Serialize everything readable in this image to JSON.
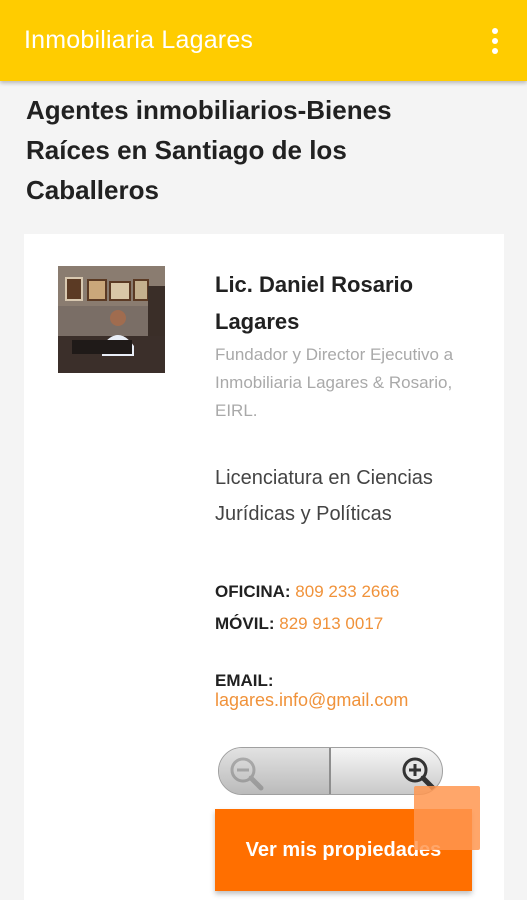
{
  "app": {
    "title": "Inmobiliaria Lagares",
    "menu_icon": "more-vert-icon"
  },
  "page": {
    "heading": "Agentes inmobiliarios-Bienes Raíces en Santiago de los Caballeros"
  },
  "agent": {
    "name": "Lic. Daniel Rosario Lagares",
    "role": "Fundador y Director Ejecutivo a Inmobiliaria Lagares & Rosario, EIRL.",
    "degree": "Licenciatura en Ciencias Jurídicas y Políticas",
    "office_label": "OFICINA:",
    "office_phone": "809 233 2666",
    "mobile_label": "MÓVIL:",
    "mobile_phone": "829 913 0017",
    "email_label": "EMAIL:",
    "email": "lagares.info@gmail.com"
  },
  "zoom": {
    "out_icon": "zoom-out-icon",
    "in_icon": "zoom-in-icon"
  },
  "actions": {
    "view_properties_label": "Ver mis propiedades"
  },
  "colors": {
    "app_bar": "#ffcc00",
    "link": "#f0923a",
    "button": "#ff6f00"
  }
}
